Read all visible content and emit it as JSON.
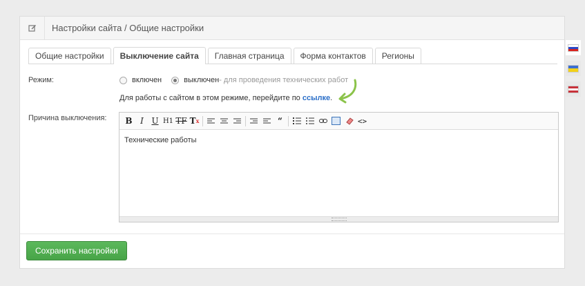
{
  "header": {
    "title": "Настройки сайта / Общие настройки",
    "icon": "edit-icon"
  },
  "tabs": [
    {
      "label": "Общие настройки",
      "active": false
    },
    {
      "label": "Выключение сайта",
      "active": true
    },
    {
      "label": "Главная страница",
      "active": false
    },
    {
      "label": "Форма контактов",
      "active": false
    },
    {
      "label": "Регионы",
      "active": false
    }
  ],
  "mode": {
    "label": "Режим:",
    "option_on": "включен",
    "option_off": "выключен",
    "selected": "выключен",
    "hint": " - для проведения технических работ",
    "note_text": "Для работы с сайтом в этом режиме, перейдите по ",
    "note_link": "ссылке",
    "note_end": "."
  },
  "reason": {
    "label": "Причина выключения:",
    "content": "Технические работы",
    "toolbar": [
      "bold-icon",
      "italic-icon",
      "underline-icon",
      "heading-icon",
      "strikethrough-icon",
      "clear-format-icon",
      "align-left-icon",
      "align-center-icon",
      "align-right-icon",
      "outdent-icon",
      "indent-icon",
      "quote-icon",
      "ordered-list-icon",
      "unordered-list-icon",
      "link-icon",
      "fullscreen-icon",
      "eraser-icon",
      "code-icon"
    ]
  },
  "save_label": "Сохранить настройки",
  "languages": [
    {
      "name": "ru",
      "active": true,
      "colors": [
        "#ffffff",
        "#2b49c7",
        "#d8231f"
      ]
    },
    {
      "name": "ua",
      "active": false,
      "colors": [
        "#3b6fd1",
        "#f3d117"
      ]
    },
    {
      "name": "us",
      "active": false,
      "colors": [
        "#c8323a",
        "#ffffff",
        "#3a4fa0"
      ]
    }
  ]
}
